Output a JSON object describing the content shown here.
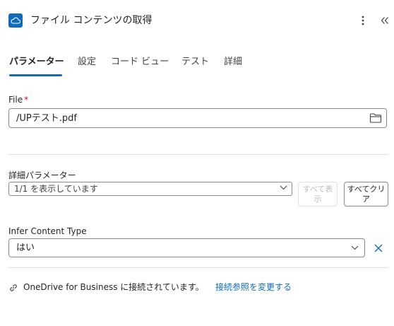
{
  "header": {
    "title": "ファイル コンテンツの取得",
    "app_icon": "onedrive-cloud-icon",
    "more_icon": "more-vertical-icon",
    "collapse_icon": "double-chevron-left-icon"
  },
  "tabs": [
    {
      "label": "パラメーター",
      "active": true
    },
    {
      "label": "設定",
      "active": false
    },
    {
      "label": "コード ビュー",
      "active": false
    },
    {
      "label": "テスト",
      "active": false
    },
    {
      "label": "詳細",
      "active": false
    }
  ],
  "file_field": {
    "label": "File",
    "required_mark": "*",
    "value": "/UPテスト.pdf",
    "icon": "folder-icon"
  },
  "advanced": {
    "label": "詳細パラメーター",
    "summary": "1/1 を表示しています",
    "show_all_label": "すべて表示",
    "clear_all_label": "すべてクリア"
  },
  "infer_field": {
    "label": "Infer Content Type",
    "value": "はい"
  },
  "connection": {
    "text": "OneDrive for Business に接続されています。",
    "change_link": "接続参照を変更する",
    "icon": "link-icon"
  },
  "colors": {
    "accent": "#0f6cbd",
    "required": "#c50f1f",
    "divider": "#e0e0e0"
  }
}
